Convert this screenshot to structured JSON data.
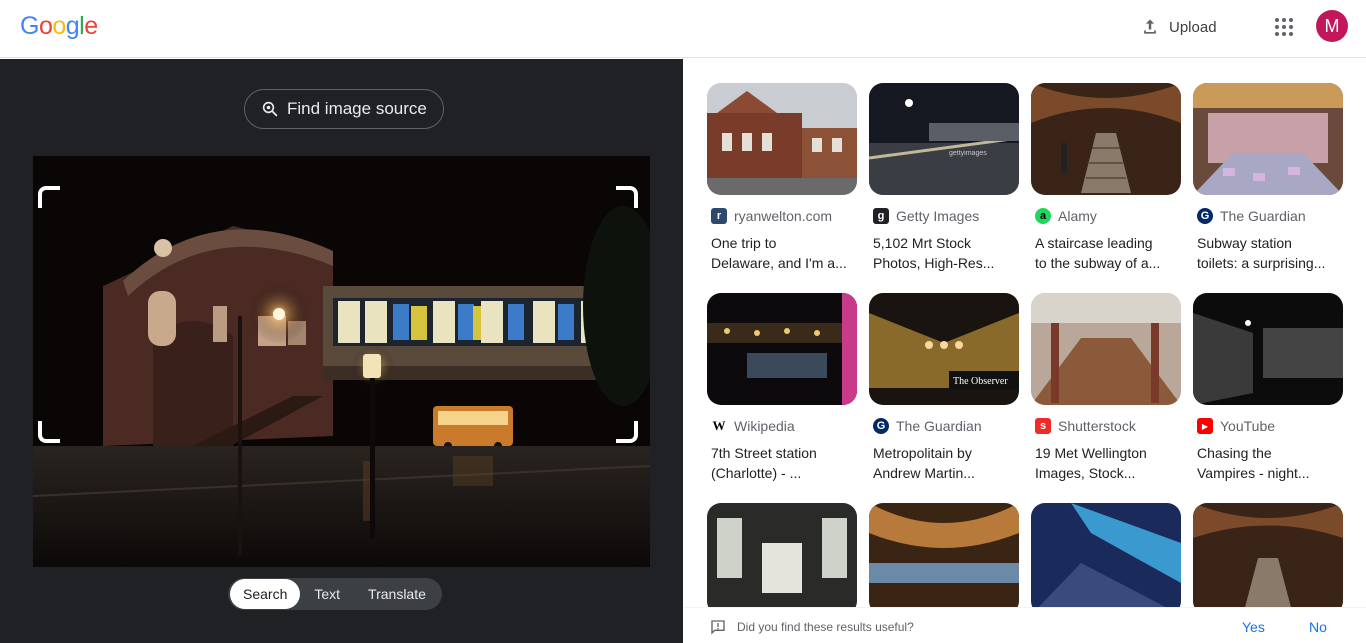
{
  "header": {
    "logo_letters": [
      {
        "ch": "G",
        "color": "#4285F4"
      },
      {
        "ch": "o",
        "color": "#EA4335"
      },
      {
        "ch": "o",
        "color": "#FBBC05"
      },
      {
        "ch": "g",
        "color": "#4285F4"
      },
      {
        "ch": "l",
        "color": "#34A853"
      },
      {
        "ch": "e",
        "color": "#EA4335"
      }
    ],
    "upload_label": "Upload",
    "upload_icon": "upload-icon",
    "apps_icon": "apps-grid-icon",
    "avatar_letter": "M",
    "avatar_color": "#C2185B"
  },
  "lens": {
    "find_source_label": "Find image source",
    "find_source_icon": "lens-search-icon",
    "modes": [
      {
        "label": "Search",
        "active": true
      },
      {
        "label": "Text",
        "active": false
      },
      {
        "label": "Translate",
        "active": false
      }
    ]
  },
  "results": [
    {
      "source": "ryanwelton.com",
      "favicon": "ryanwelton-favicon",
      "title1": "One trip to",
      "title2": "Delaware, and I'm a..."
    },
    {
      "source": "Getty Images",
      "favicon": "getty-favicon",
      "title1": "5,102 Mrt Stock",
      "title2": "Photos, High-Res..."
    },
    {
      "source": "Alamy",
      "favicon": "alamy-favicon",
      "title1": "A staircase leading",
      "title2": "to the subway of a..."
    },
    {
      "source": "The Guardian",
      "favicon": "guardian-favicon",
      "title1": "Subway station",
      "title2": "toilets: a surprising..."
    },
    {
      "source": "Wikipedia",
      "favicon": "wikipedia-favicon",
      "title1": "7th Street station",
      "title2": "(Charlotte) - ..."
    },
    {
      "source": "The Guardian",
      "favicon": "guardian-favicon",
      "title1": "Metropolitain by",
      "title2": "Andrew Martin..."
    },
    {
      "source": "Shutterstock",
      "favicon": "shutterstock-favicon",
      "title1": "19 Met Wellington",
      "title2": "Images, Stock..."
    },
    {
      "source": "YouTube",
      "favicon": "youtube-favicon",
      "title1": "Chasing the",
      "title2": "Vampires - night..."
    },
    {
      "source": "",
      "favicon": "",
      "title1": "",
      "title2": ""
    },
    {
      "source": "",
      "favicon": "",
      "title1": "",
      "title2": ""
    },
    {
      "source": "",
      "favicon": "",
      "title1": "",
      "title2": ""
    },
    {
      "source": "",
      "favicon": "",
      "title1": "",
      "title2": ""
    }
  ],
  "thumb_watermarks": {
    "getty": "gettyimages",
    "observer": "The Observer"
  },
  "feedback": {
    "question": "Did you find these results useful?",
    "yes": "Yes",
    "no": "No"
  }
}
